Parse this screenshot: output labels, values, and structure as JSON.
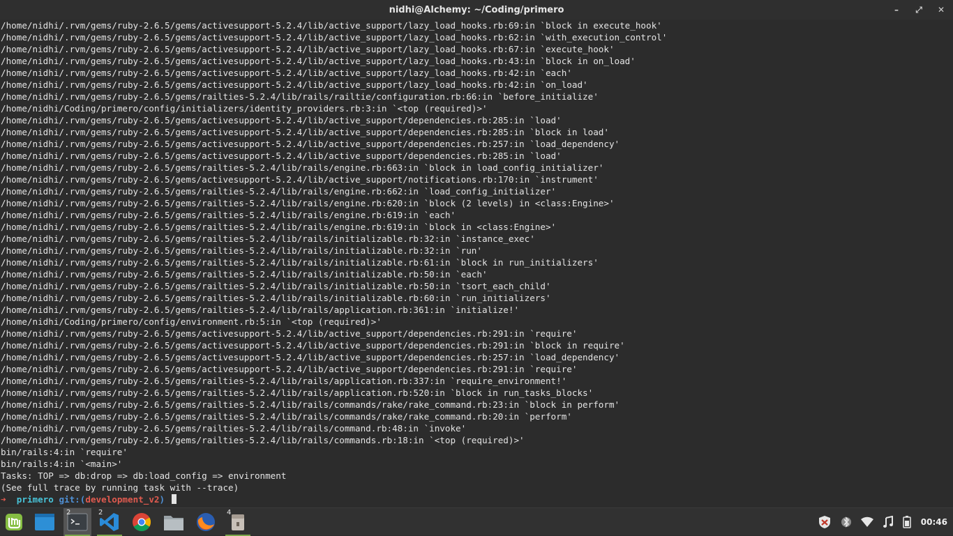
{
  "window": {
    "title": "nidhi@Alchemy: ~/Coding/primero",
    "controls": [
      "minimize",
      "restore",
      "close"
    ]
  },
  "terminal": {
    "lines": [
      "/home/nidhi/.rvm/gems/ruby-2.6.5/gems/activesupport-5.2.4/lib/active_support/lazy_load_hooks.rb:69:in `block in execute_hook'",
      "/home/nidhi/.rvm/gems/ruby-2.6.5/gems/activesupport-5.2.4/lib/active_support/lazy_load_hooks.rb:62:in `with_execution_control'",
      "/home/nidhi/.rvm/gems/ruby-2.6.5/gems/activesupport-5.2.4/lib/active_support/lazy_load_hooks.rb:67:in `execute_hook'",
      "/home/nidhi/.rvm/gems/ruby-2.6.5/gems/activesupport-5.2.4/lib/active_support/lazy_load_hooks.rb:43:in `block in on_load'",
      "/home/nidhi/.rvm/gems/ruby-2.6.5/gems/activesupport-5.2.4/lib/active_support/lazy_load_hooks.rb:42:in `each'",
      "/home/nidhi/.rvm/gems/ruby-2.6.5/gems/activesupport-5.2.4/lib/active_support/lazy_load_hooks.rb:42:in `on_load'",
      "/home/nidhi/.rvm/gems/ruby-2.6.5/gems/railties-5.2.4/lib/rails/railtie/configuration.rb:66:in `before_initialize'",
      "/home/nidhi/Coding/primero/config/initializers/identity_providers.rb:3:in `<top (required)>'",
      "/home/nidhi/.rvm/gems/ruby-2.6.5/gems/activesupport-5.2.4/lib/active_support/dependencies.rb:285:in `load'",
      "/home/nidhi/.rvm/gems/ruby-2.6.5/gems/activesupport-5.2.4/lib/active_support/dependencies.rb:285:in `block in load'",
      "/home/nidhi/.rvm/gems/ruby-2.6.5/gems/activesupport-5.2.4/lib/active_support/dependencies.rb:257:in `load_dependency'",
      "/home/nidhi/.rvm/gems/ruby-2.6.5/gems/activesupport-5.2.4/lib/active_support/dependencies.rb:285:in `load'",
      "/home/nidhi/.rvm/gems/ruby-2.6.5/gems/railties-5.2.4/lib/rails/engine.rb:663:in `block in load_config_initializer'",
      "/home/nidhi/.rvm/gems/ruby-2.6.5/gems/activesupport-5.2.4/lib/active_support/notifications.rb:170:in `instrument'",
      "/home/nidhi/.rvm/gems/ruby-2.6.5/gems/railties-5.2.4/lib/rails/engine.rb:662:in `load_config_initializer'",
      "/home/nidhi/.rvm/gems/ruby-2.6.5/gems/railties-5.2.4/lib/rails/engine.rb:620:in `block (2 levels) in <class:Engine>'",
      "/home/nidhi/.rvm/gems/ruby-2.6.5/gems/railties-5.2.4/lib/rails/engine.rb:619:in `each'",
      "/home/nidhi/.rvm/gems/ruby-2.6.5/gems/railties-5.2.4/lib/rails/engine.rb:619:in `block in <class:Engine>'",
      "/home/nidhi/.rvm/gems/ruby-2.6.5/gems/railties-5.2.4/lib/rails/initializable.rb:32:in `instance_exec'",
      "/home/nidhi/.rvm/gems/ruby-2.6.5/gems/railties-5.2.4/lib/rails/initializable.rb:32:in `run'",
      "/home/nidhi/.rvm/gems/ruby-2.6.5/gems/railties-5.2.4/lib/rails/initializable.rb:61:in `block in run_initializers'",
      "/home/nidhi/.rvm/gems/ruby-2.6.5/gems/railties-5.2.4/lib/rails/initializable.rb:50:in `each'",
      "/home/nidhi/.rvm/gems/ruby-2.6.5/gems/railties-5.2.4/lib/rails/initializable.rb:50:in `tsort_each_child'",
      "/home/nidhi/.rvm/gems/ruby-2.6.5/gems/railties-5.2.4/lib/rails/initializable.rb:60:in `run_initializers'",
      "/home/nidhi/.rvm/gems/ruby-2.6.5/gems/railties-5.2.4/lib/rails/application.rb:361:in `initialize!'",
      "/home/nidhi/Coding/primero/config/environment.rb:5:in `<top (required)>'",
      "/home/nidhi/.rvm/gems/ruby-2.6.5/gems/activesupport-5.2.4/lib/active_support/dependencies.rb:291:in `require'",
      "/home/nidhi/.rvm/gems/ruby-2.6.5/gems/activesupport-5.2.4/lib/active_support/dependencies.rb:291:in `block in require'",
      "/home/nidhi/.rvm/gems/ruby-2.6.5/gems/activesupport-5.2.4/lib/active_support/dependencies.rb:257:in `load_dependency'",
      "/home/nidhi/.rvm/gems/ruby-2.6.5/gems/activesupport-5.2.4/lib/active_support/dependencies.rb:291:in `require'",
      "/home/nidhi/.rvm/gems/ruby-2.6.5/gems/railties-5.2.4/lib/rails/application.rb:337:in `require_environment!'",
      "/home/nidhi/.rvm/gems/ruby-2.6.5/gems/railties-5.2.4/lib/rails/application.rb:520:in `block in run_tasks_blocks'",
      "/home/nidhi/.rvm/gems/ruby-2.6.5/gems/railties-5.2.4/lib/rails/commands/rake/rake_command.rb:23:in `block in perform'",
      "/home/nidhi/.rvm/gems/ruby-2.6.5/gems/railties-5.2.4/lib/rails/commands/rake/rake_command.rb:20:in `perform'",
      "/home/nidhi/.rvm/gems/ruby-2.6.5/gems/railties-5.2.4/lib/rails/command.rb:48:in `invoke'",
      "/home/nidhi/.rvm/gems/ruby-2.6.5/gems/railties-5.2.4/lib/rails/commands.rb:18:in `<top (required)>'",
      "bin/rails:4:in `require'",
      "bin/rails:4:in `<main>'",
      "Tasks: TOP => db:drop => db:load_config => environment",
      "(See full trace by running task with --trace)"
    ],
    "prompt": {
      "arrow": "➜",
      "dir": "primero",
      "git_label": "git:(",
      "branch": "development_v2",
      "git_close": ")"
    }
  },
  "taskbar": {
    "apps": [
      {
        "name": "mint-menu",
        "badge": ""
      },
      {
        "name": "show-desktop",
        "badge": ""
      },
      {
        "name": "terminal",
        "badge": "2"
      },
      {
        "name": "vscode",
        "badge": "2"
      },
      {
        "name": "chrome",
        "badge": ""
      },
      {
        "name": "files",
        "badge": ""
      },
      {
        "name": "firefox",
        "badge": ""
      },
      {
        "name": "archive",
        "badge": "4"
      }
    ],
    "clock": "00:46"
  },
  "colors": {
    "terminal_bg": "#2c2c2c",
    "prompt_arrow": "#e05a4f",
    "prompt_dir": "#48c3d8",
    "prompt_git": "#4f8fd4",
    "prompt_branch": "#e05a4f",
    "mint_green": "#7aa64a"
  }
}
